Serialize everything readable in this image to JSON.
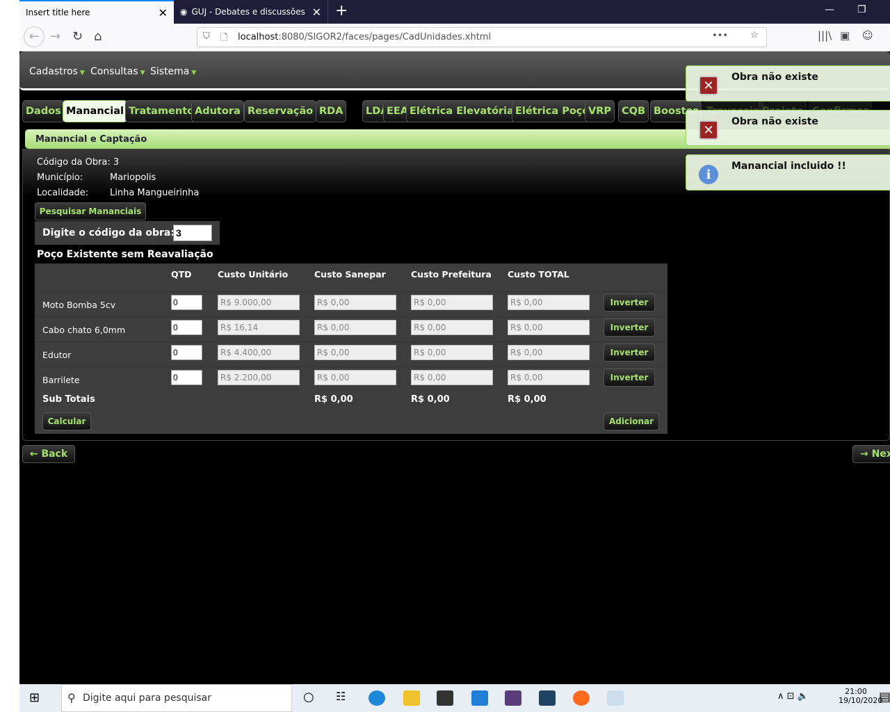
{
  "browser": {
    "tabs": [
      {
        "title": "Insert title here"
      },
      {
        "title": "GUJ - Debates e discussões sob"
      }
    ],
    "url_host": "localhost",
    "url_rest": ":8080/SIGOR2/faces/pages/CadUnidades.xhtml"
  },
  "menu": [
    "Cadastros",
    "Consultas",
    "Sistema"
  ],
  "tabs": [
    "Dados",
    "Manancial",
    "Tratamento",
    "Adutora",
    "Reservação",
    "RDA",
    "LDA",
    "EEAT",
    "Elétrica Elevatória",
    "Elétrica Poço",
    "VRP",
    "CQB",
    "Booster",
    "Travessia",
    "Projeto",
    "Confirmar"
  ],
  "active_tab": "Manancial",
  "panel": {
    "title": "Manancial e Captação",
    "codigo_label": "Código da Obra: 3",
    "municipio_label": "Município:",
    "municipio": "Mariopolis",
    "localidade_label": "Localidade:",
    "localidade": "Linha Mangueirinha",
    "search_button": "Pesquisar Mananciais",
    "code_prompt": "Digite o código da obra:",
    "code_value": "3",
    "section_title": "Poço Existente sem Reavaliação"
  },
  "table": {
    "headers": [
      "QTD",
      "Custo Unitário",
      "Custo Sanepar",
      "Custo Prefeitura",
      "Custo TOTAL"
    ],
    "rows": [
      {
        "item": "Moto Bomba 5cv",
        "qtd": "0",
        "unit": "R$ 9.000,00",
        "sanepar": "R$ 0,00",
        "prefeitura": "R$ 0,00",
        "total": "R$ 0,00",
        "action": "Inverter"
      },
      {
        "item": "Cabo chato 6,0mm",
        "qtd": "0",
        "unit": "R$ 16,14",
        "sanepar": "R$ 0,00",
        "prefeitura": "R$ 0,00",
        "total": "R$ 0,00",
        "action": "Inverter"
      },
      {
        "item": "Edutor",
        "qtd": "0",
        "unit": "R$ 4.400,00",
        "sanepar": "R$ 0,00",
        "prefeitura": "R$ 0,00",
        "total": "R$ 0,00",
        "action": "Inverter"
      },
      {
        "item": "Barrilete",
        "qtd": "0",
        "unit": "R$ 2.200,00",
        "sanepar": "R$ 0,00",
        "prefeitura": "R$ 0,00",
        "total": "R$ 0,00",
        "action": "Inverter"
      }
    ],
    "subtotal_label": "Sub Totais",
    "subtotals": [
      "R$ 0,00",
      "R$ 0,00",
      "R$ 0,00"
    ],
    "calc_button": "Calcular",
    "add_button": "Adicionar"
  },
  "nav": {
    "back": "Back",
    "next": "Nex"
  },
  "growls": [
    {
      "type": "error",
      "text": "Obra não existe"
    },
    {
      "type": "error",
      "text": "Obra não existe"
    },
    {
      "type": "info",
      "text": "Manancial incluido !!"
    }
  ],
  "taskbar": {
    "search_placeholder": "Digite aqui para pesquisar",
    "time": "21:00",
    "date": "19/10/2020"
  }
}
